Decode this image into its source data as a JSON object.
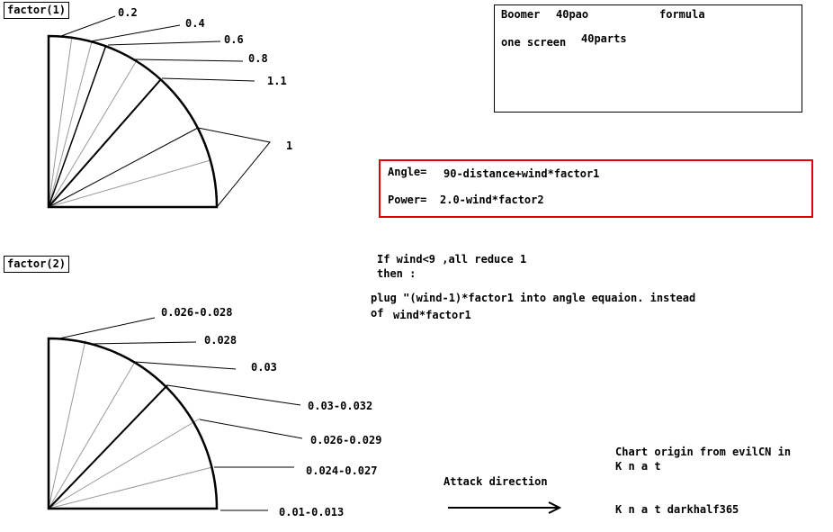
{
  "diagram1": {
    "title": "factor(1)",
    "labels": [
      "0.2",
      "0.4",
      "0.6",
      "0.8",
      "1.1",
      "1"
    ]
  },
  "diagram2": {
    "title": "factor(2)",
    "labels": [
      "0.026-0.028",
      "0.028",
      "0.03",
      "0.03-0.032",
      "0.026-0.029",
      "0.024-0.027",
      "0.01-0.013"
    ]
  },
  "info": {
    "boomer": "Boomer",
    "pao": "40pao",
    "formula": "formula",
    "one_screen": "one screen",
    "parts": "40parts"
  },
  "formulas": {
    "angle_label": "Angle=",
    "angle_expr": "90-distance+wind*factor1",
    "power_label": "Power=",
    "power_expr": "2.0-wind*factor2"
  },
  "notes": {
    "line1": "If wind<9 ,all reduce 1",
    "line2": "then :",
    "line3": "plug \"(wind-1)*factor1 into angle equaion. instead",
    "line4a": "of",
    "line4b": "wind*factor1"
  },
  "attack": {
    "label": "Attack direction"
  },
  "credits": {
    "line1": "Chart origin from evilCN in",
    "line2": "K n a t",
    "line3": "K n a t darkhalf365"
  }
}
